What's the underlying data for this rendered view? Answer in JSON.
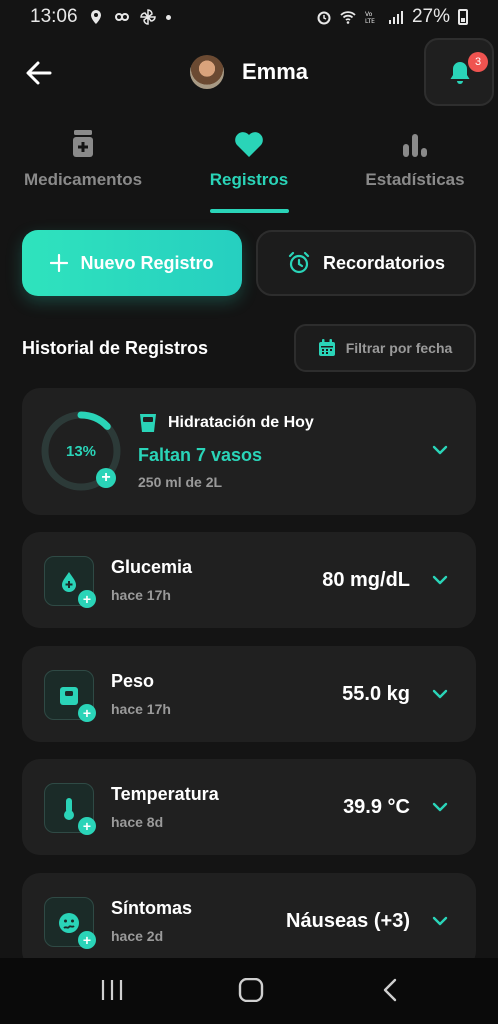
{
  "status_bar": {
    "time": "13:06",
    "battery": "27%",
    "icons": [
      "location-icon",
      "link-icon",
      "pinwheel-icon",
      "alarm-icon",
      "wifi-icon",
      "volte-icon",
      "signal-icon",
      "battery-icon"
    ]
  },
  "header": {
    "user_name": "Emma",
    "notification_count": "3"
  },
  "tabs": [
    {
      "label": "Medicamentos",
      "icon": "medicine-bottle-icon",
      "active": false
    },
    {
      "label": "Registros",
      "icon": "heart-icon",
      "active": true
    },
    {
      "label": "Estadísticas",
      "icon": "bar-chart-icon",
      "active": false
    }
  ],
  "actions": {
    "new_record": "Nuevo Registro",
    "reminders": "Recordatorios"
  },
  "history": {
    "title": "Historial de Registros",
    "filter_label": "Filtrar por fecha"
  },
  "hydration": {
    "title": "Hidratación de Hoy",
    "percent_label": "13%",
    "progress": 0.13,
    "remaining": "Faltan 7 vasos",
    "detail": "250 ml de 2L"
  },
  "records": [
    {
      "name": "Glucemia",
      "time": "hace 17h",
      "value": "80 mg/dL",
      "icon": "glucose-drop-icon"
    },
    {
      "name": "Peso",
      "time": "hace 17h",
      "value": "55.0 kg",
      "icon": "scale-icon"
    },
    {
      "name": "Temperatura",
      "time": "hace 8d",
      "value": "39.9 °C",
      "icon": "thermometer-icon"
    },
    {
      "name": "Síntomas",
      "time": "hace 2d",
      "value": "Náuseas (+3)",
      "icon": "sick-face-icon"
    }
  ],
  "colors": {
    "accent": "#2ad4b8",
    "background": "#141414",
    "card": "#202020",
    "badge": "#ef5350"
  }
}
